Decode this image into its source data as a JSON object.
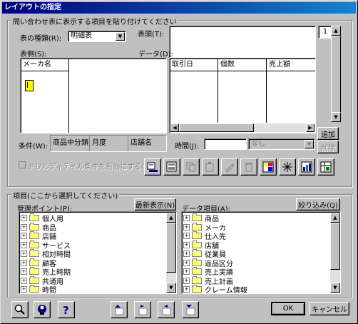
{
  "window": {
    "title": "レイアウトの指定"
  },
  "upper_group": {
    "title": "問い合わせ表に表示する項目を貼り付けてください",
    "table_type_label": "表の種類(R):",
    "table_type_value": "明細表",
    "header_label": "表頭(T):",
    "side_label": "表側(S):",
    "data_label": "データ(D):",
    "side_column": "メーカ名",
    "data_columns": [
      "取引日",
      "個数",
      "売上額"
    ],
    "page_number": "1",
    "add_button": "追加",
    "delete_button": "削除",
    "condition_label": "条件(W):",
    "conditions": [
      "商品中分類",
      "月度",
      "店舗名"
    ],
    "time_label": "時間(J):",
    "time_value": "",
    "time_select_value": "なし",
    "drill_checkbox_label": "ドリルディテイル条件を有効にする(L)",
    "tool_icons": [
      "preview-icon",
      "layout-icon",
      "copy-icon",
      "paste-icon",
      "edit-icon",
      "trash-icon",
      "pivot-icon",
      "expand-icon",
      "chart-icon",
      "grid-settings-icon"
    ]
  },
  "lower_group": {
    "title": "項目(ここから選択してください)",
    "mgmt_label": "管理ポイント(P):",
    "refresh_button": "最新表示(N)",
    "mgmt_items": [
      "個人用",
      "商品",
      "店舗",
      "サービス",
      "相対時間",
      "顧客",
      "売上時期",
      "共通用",
      "時間"
    ],
    "data_items_label": "データ項目(A):",
    "filter_button": "絞り込み(Q)",
    "data_items": [
      "商品",
      "メーカ",
      "仕入先",
      "店舗",
      "従業員",
      "返品区分",
      "売上実績",
      "売上計画",
      "クレーム情報"
    ]
  },
  "footer": {
    "ok_button": "OK",
    "cancel_button": "キャンセル",
    "left_icons": [
      "search-icon",
      "user-help-icon",
      "help-icon"
    ],
    "mid_icons": [
      "move-up-icon",
      "move-right-icon",
      "move-left-icon",
      "move-down-icon"
    ]
  }
}
